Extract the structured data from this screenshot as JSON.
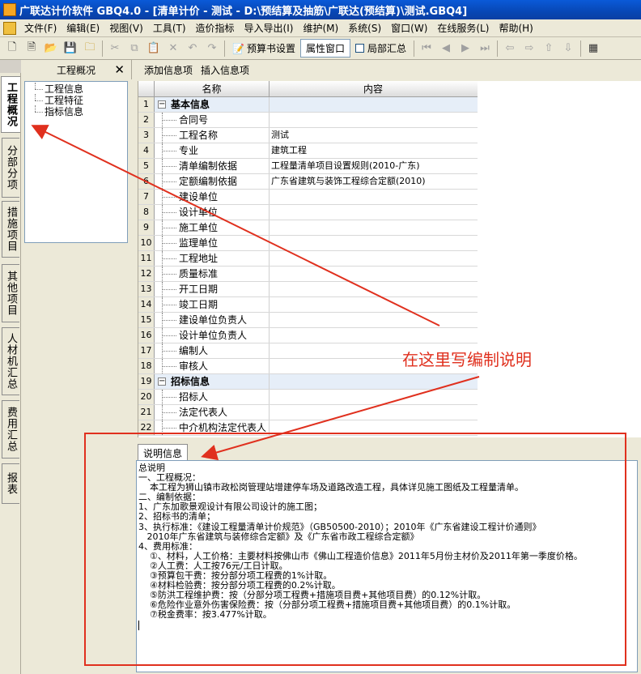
{
  "window": {
    "title": "广联达计价软件 GBQ4.0 - [清单计价 - 测试 - D:\\预结算及抽筋\\广联达(预结算)\\测试.GBQ4]"
  },
  "menu": {
    "items": [
      "文件(F)",
      "编辑(E)",
      "视图(V)",
      "工具(T)",
      "造价指标",
      "导入导出(I)",
      "维护(M)",
      "系统(S)",
      "窗口(W)",
      "在线服务(L)",
      "帮助(H)"
    ]
  },
  "toolbar": {
    "budget_settings": "预算书设置",
    "property_window": "属性窗口",
    "local_summary": "局部汇总"
  },
  "vertical_tabs": [
    {
      "label": "工程概况",
      "active": true
    },
    {
      "label": "分部分项",
      "active": false
    },
    {
      "label": "措施项目",
      "active": false
    },
    {
      "label": "其他项目",
      "active": false
    },
    {
      "label": "人材机汇总",
      "active": false
    },
    {
      "label": "费用汇总",
      "active": false
    },
    {
      "label": "报表",
      "active": false
    }
  ],
  "left_panel": {
    "title": "工程概况",
    "tree": [
      "工程信息",
      "工程特征",
      "指标信息"
    ]
  },
  "sub_toolbar": {
    "add_item": "添加信息项",
    "insert_item": "插入信息项"
  },
  "grid": {
    "headers": {
      "name": "名称",
      "content": "内容"
    },
    "rows": [
      {
        "num": "1",
        "name": "基本信息",
        "content": "",
        "group": true
      },
      {
        "num": "2",
        "name": "合同号",
        "content": ""
      },
      {
        "num": "3",
        "name": "工程名称",
        "content": "测试"
      },
      {
        "num": "4",
        "name": "专业",
        "content": "建筑工程"
      },
      {
        "num": "5",
        "name": "清单编制依据",
        "content": "工程量清单项目设置规则(2010-广东)"
      },
      {
        "num": "6",
        "name": "定额编制依据",
        "content": "广东省建筑与装饰工程综合定额(2010)"
      },
      {
        "num": "7",
        "name": "建设单位",
        "content": ""
      },
      {
        "num": "8",
        "name": "设计单位",
        "content": ""
      },
      {
        "num": "9",
        "name": "施工单位",
        "content": ""
      },
      {
        "num": "10",
        "name": "监理单位",
        "content": ""
      },
      {
        "num": "11",
        "name": "工程地址",
        "content": ""
      },
      {
        "num": "12",
        "name": "质量标准",
        "content": ""
      },
      {
        "num": "13",
        "name": "开工日期",
        "content": ""
      },
      {
        "num": "14",
        "name": "竣工日期",
        "content": ""
      },
      {
        "num": "15",
        "name": "建设单位负责人",
        "content": ""
      },
      {
        "num": "16",
        "name": "设计单位负责人",
        "content": ""
      },
      {
        "num": "17",
        "name": "编制人",
        "content": ""
      },
      {
        "num": "18",
        "name": "审核人",
        "content": ""
      },
      {
        "num": "19",
        "name": "招标信息",
        "content": "",
        "group": true
      },
      {
        "num": "20",
        "name": "招标人",
        "content": ""
      },
      {
        "num": "21",
        "name": "法定代表人",
        "content": ""
      },
      {
        "num": "22",
        "name": "中介机构法定代表人",
        "content": ""
      }
    ]
  },
  "description": {
    "tab_label": "说明信息",
    "lines": [
      "总说明",
      "一、工程概况：",
      "    本工程为狮山镇市政松岗管理站增建停车场及道路改造工程，具体详见施工图纸及工程量清单。",
      "二、编制依据：",
      "1、广东加歌景观设计有限公司设计的施工图；",
      "2、招标书的清单；",
      "3、执行标准：《建设工程量清单计价规范》（GB50500-2010）；2010年《广东省建设工程计价通则》",
      "   2010年广东省建筑与装修综合定额》及《广东省市政工程综合定额》",
      "4、费用标准：",
      "    ①、材料，人工价格：主要材料按佛山市《佛山工程造价信息》2011年5月份主材价及2011年第一季度价格。",
      "    ②人工费：人工按76元/工日计取。",
      "    ③预算包干费：按分部分项工程费的1%计取。",
      "    ④材料检验费：按分部分项工程费的0.2%计取。",
      "    ⑤防洪工程维护费：按（分部分项工程费+措施项目费+其他项目费）的0.12%计取。",
      "    ⑥危险作业意外伤害保险费：按（分部分项工程费+措施项目费+其他项目费）的0.1%计取。",
      "    ⑦税金费率：按3.477%计取。"
    ]
  },
  "annotation": {
    "text": "在这里写编制说明",
    "color": "#e0301e"
  }
}
